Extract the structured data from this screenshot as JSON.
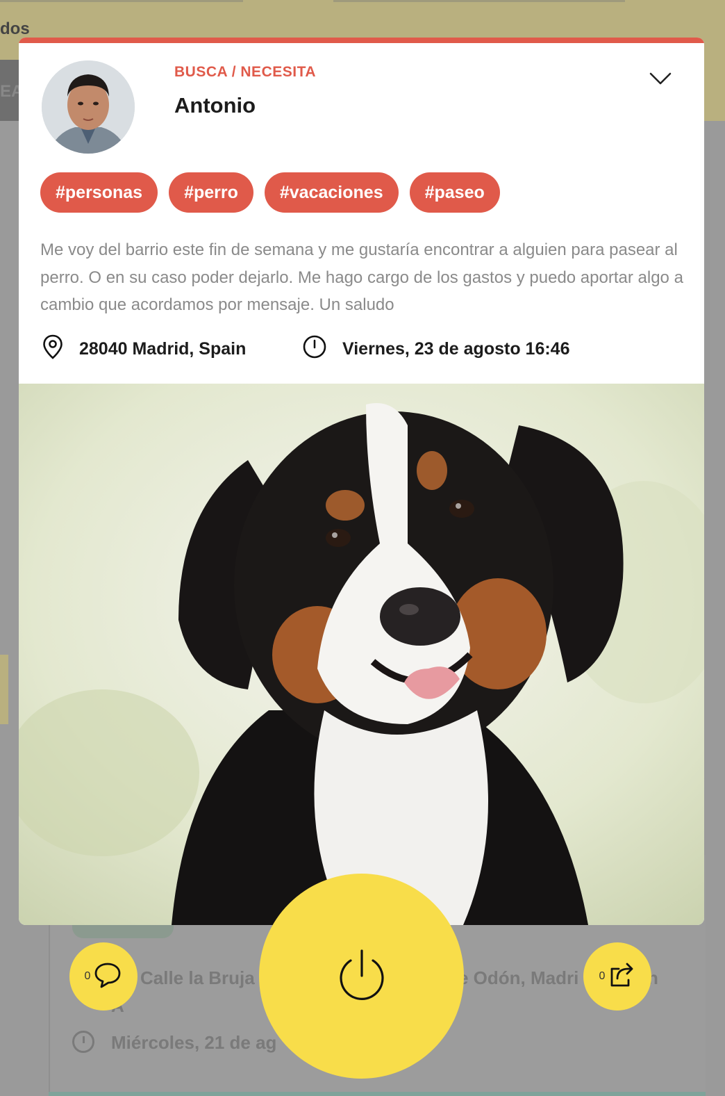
{
  "background": {
    "header_fragment": "dos",
    "nav_fragment": "EA",
    "card_location_left": "Calle la Bruja",
    "card_location_right": "e Odón, Madri",
    "card_location_tail": "n",
    "card_location_wrap": "A",
    "card_time": "Miércoles, 21 de ag"
  },
  "post": {
    "kind": "BUSCA / NECESITA",
    "author": "Antonio",
    "tags": [
      "#personas",
      "#perro",
      "#vacaciones",
      "#paseo"
    ],
    "description": "Me voy del barrio este fin de semana y me gustaría encontrar a alguien para pasear al perro. O en su caso poder dejarlo. Me hago cargo de los gastos y puedo aportar algo a cambio que acordamos por mensaje. Un saludo",
    "location": "28040 Madrid, Spain",
    "datetime": "Viernes, 23 de agosto 16:46"
  },
  "actions": {
    "comment_count": "0",
    "share_count": "0"
  },
  "colors": {
    "accent": "#e05a4a",
    "fab": "#f8dd4a",
    "overlay": "#9a9a9a"
  },
  "icons": {
    "expand": "chevron-down-icon",
    "location": "map-pin-icon",
    "time": "clock-icon",
    "comment": "speech-bubble-icon",
    "power": "power-icon",
    "share": "share-arrow-icon"
  }
}
